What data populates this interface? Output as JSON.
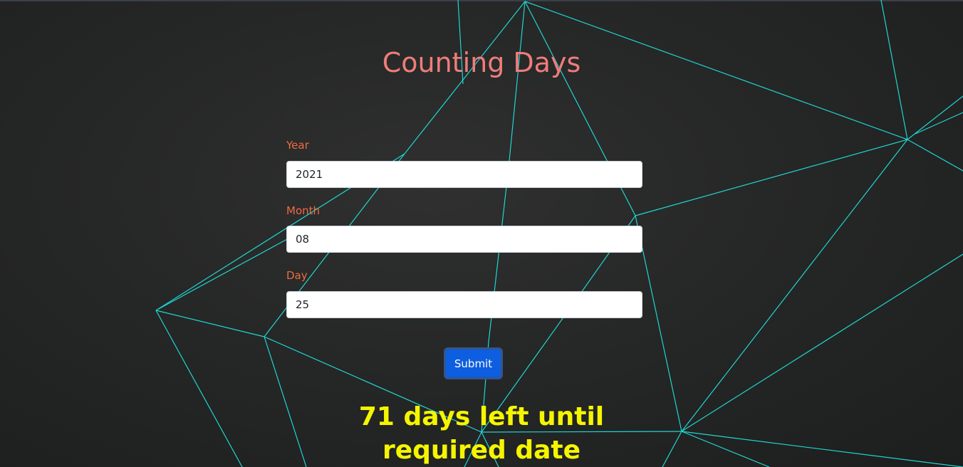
{
  "page": {
    "title": "Counting Days"
  },
  "form": {
    "year": {
      "label": "Year",
      "value": "2021"
    },
    "month": {
      "label": "Month",
      "value": "08"
    },
    "day": {
      "label": "Day",
      "value": "25"
    },
    "submit_label": "Submit"
  },
  "result": {
    "text": "71 days left until required date"
  },
  "colors": {
    "title": "#ef7d7a",
    "label": "#f06a45",
    "accent_lines": "#1fd6d0",
    "button": "#0d5ee0",
    "result_text": "#f5f500",
    "background": "#262727"
  }
}
